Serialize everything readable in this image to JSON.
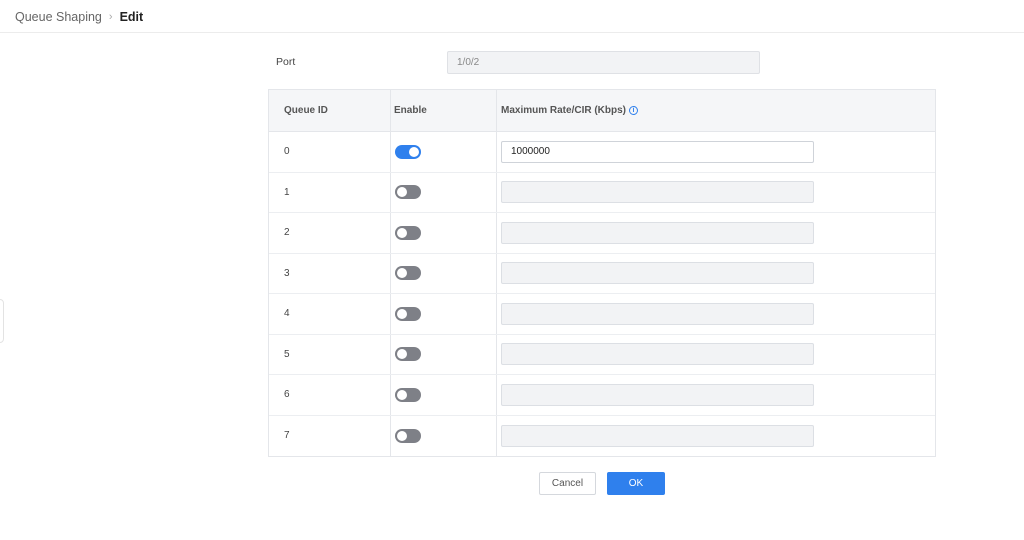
{
  "breadcrumb": {
    "parent": "Queue Shaping",
    "separator": "›",
    "current": "Edit"
  },
  "port": {
    "label": "Port",
    "value": "1/0/2"
  },
  "table": {
    "headers": {
      "queue_id": "Queue ID",
      "enable": "Enable",
      "max_rate": "Maximum Rate/CIR (Kbps)",
      "info_glyph": "i"
    },
    "rows": [
      {
        "id": "0",
        "enabled": true,
        "rate": "1000000"
      },
      {
        "id": "1",
        "enabled": false,
        "rate": ""
      },
      {
        "id": "2",
        "enabled": false,
        "rate": ""
      },
      {
        "id": "3",
        "enabled": false,
        "rate": ""
      },
      {
        "id": "4",
        "enabled": false,
        "rate": ""
      },
      {
        "id": "5",
        "enabled": false,
        "rate": ""
      },
      {
        "id": "6",
        "enabled": false,
        "rate": ""
      },
      {
        "id": "7",
        "enabled": false,
        "rate": ""
      }
    ]
  },
  "buttons": {
    "cancel": "Cancel",
    "ok": "OK"
  },
  "colors": {
    "accent": "#2f80ed",
    "toggle_off": "#7e8087",
    "disabled_field": "#f2f3f5"
  },
  "icons": {
    "info": "info-circle-icon",
    "breadcrumb_separator": "chevron-right-icon"
  }
}
